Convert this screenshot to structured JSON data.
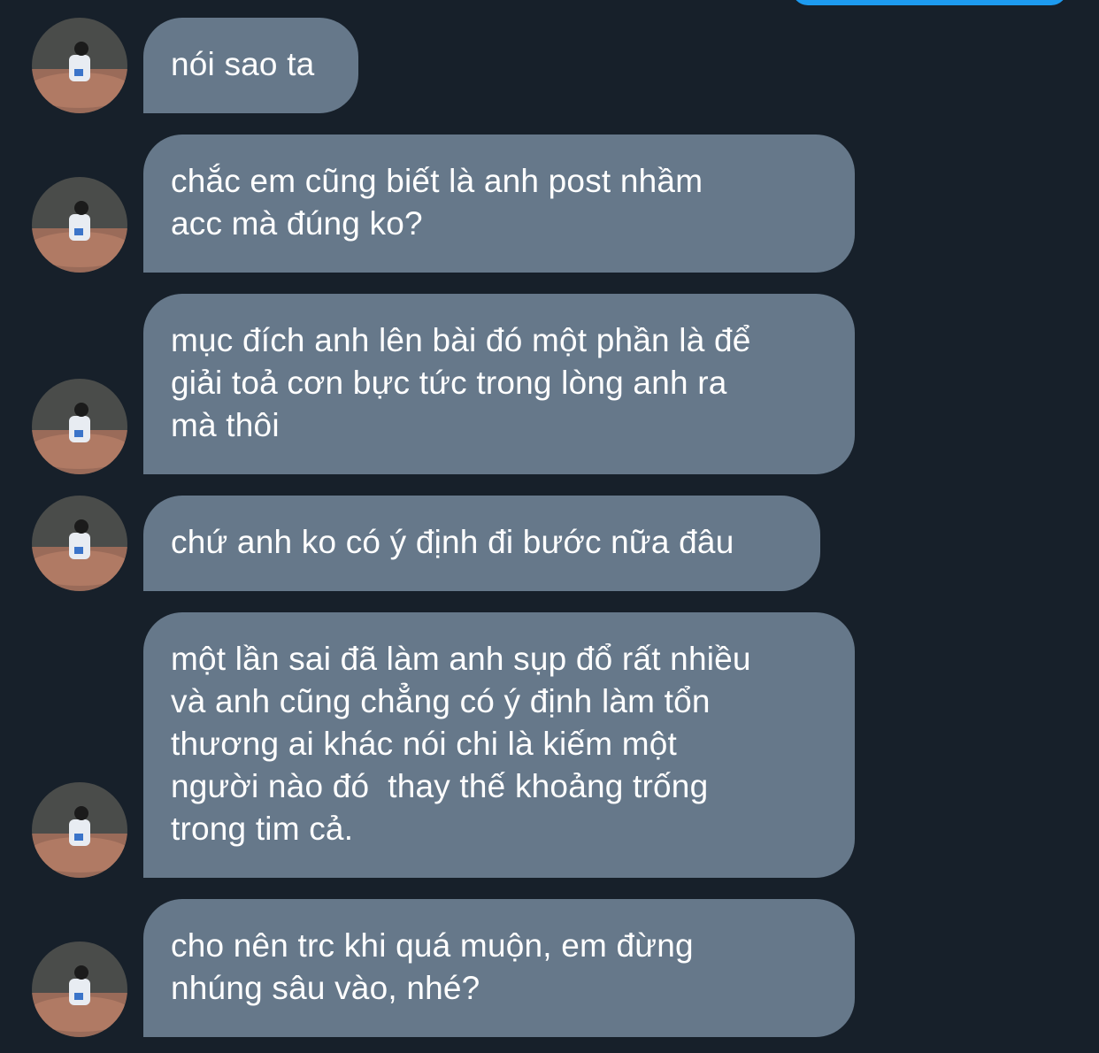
{
  "conversation": {
    "messages": [
      {
        "id": "m1",
        "direction": "received",
        "text": "nói sao ta"
      },
      {
        "id": "m2",
        "direction": "received",
        "text": "chắc em cũng biết là anh post nhầm\nacc mà đúng ko?"
      },
      {
        "id": "m3",
        "direction": "received",
        "text": "mục đích anh lên bài đó một phần là để\ngiải toả cơn bực tức trong lòng anh ra\nmà thôi"
      },
      {
        "id": "m4",
        "direction": "received",
        "text": "chứ anh ko có ý định đi bước nữa đâu"
      },
      {
        "id": "m5",
        "direction": "received",
        "text": "một lần sai đã làm anh sụp đổ rất nhiều\nvà anh cũng chẳng có ý định làm tổn\nthương ai khác nói chi là kiếm một\nngười nào đó  thay thế khoảng trống\ntrong tim cả."
      },
      {
        "id": "m6",
        "direction": "received",
        "text": "cho nên trc khi quá muộn, em đừng\nnhúng sâu vào, nhé?"
      }
    ]
  },
  "colors": {
    "background": "#17202a",
    "received_bubble": "#66788a",
    "sent_bubble": "#1d9bf0",
    "text": "#ffffff"
  },
  "icons": {
    "avatar": "avatar-photo"
  }
}
